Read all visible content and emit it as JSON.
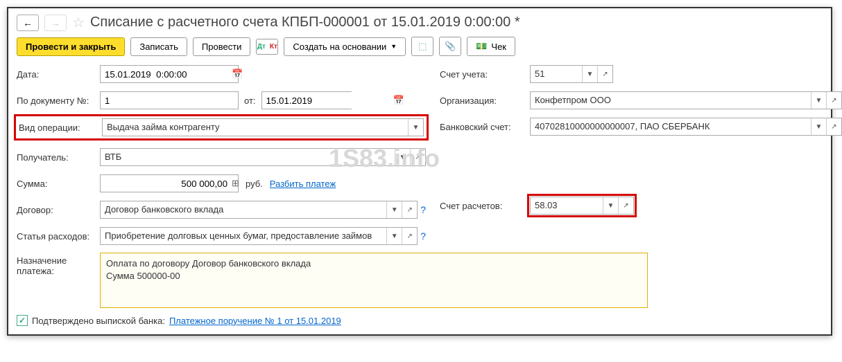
{
  "title": "Списание с расчетного счета КПБП-000001 от 15.01.2019 0:00:00 *",
  "toolbar": {
    "post_close": "Провести и закрыть",
    "save": "Записать",
    "post": "Провести",
    "create_based": "Создать на основании",
    "check": "Чек"
  },
  "labels": {
    "date": "Дата:",
    "doc_num": "По документу №:",
    "from": "от:",
    "op_type": "Вид операции:",
    "recipient": "Получатель:",
    "sum": "Сумма:",
    "currency": "руб.",
    "split": "Разбить платеж",
    "contract": "Договор:",
    "expense": "Статья расходов:",
    "purpose": "Назначение платежа:",
    "account": "Счет учета:",
    "org": "Организация:",
    "bank_acc": "Банковский счет:",
    "settle_acc": "Счет расчетов:",
    "confirmed": "Подтверждено выпиской банка:",
    "payment_order": "Платежное поручение № 1 от 15.01.2019"
  },
  "values": {
    "date": "15.01.2019  0:00:00",
    "doc_num": "1",
    "doc_date": "15.01.2019",
    "op_type": "Выдача займа контрагенту",
    "recipient": "ВТБ",
    "sum": "500 000,00",
    "contract": "Договор банковского вклада",
    "expense": "Приобретение долговых ценных бумаг, предоставление займов",
    "purpose": "Оплата по договору Договор банковского вклада\nСумма 500000-00",
    "account": "51",
    "org": "Конфетпром ООО",
    "bank_acc": "40702810000000000007, ПАО СБЕРБАНК",
    "settle_acc": "58.03"
  },
  "watermark": "1S83.info"
}
